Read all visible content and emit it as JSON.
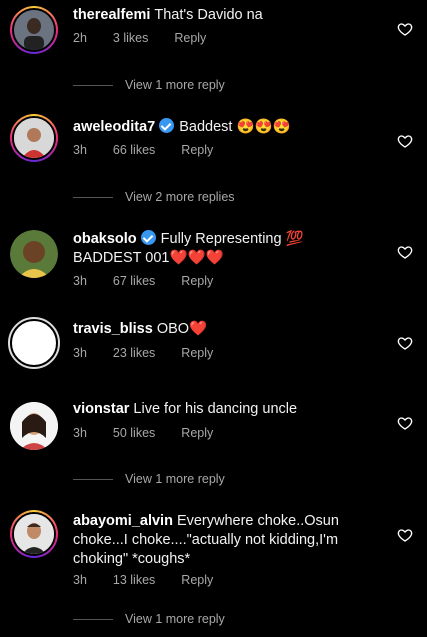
{
  "comments": [
    {
      "username": "therealfemi",
      "text": "That's Davido na",
      "time": "2h",
      "likes": "3 likes",
      "reply": "Reply"
    },
    {
      "username": "aweleodita7",
      "text": "Baddest 😍😍😍",
      "time": "3h",
      "likes": "66 likes",
      "reply": "Reply"
    },
    {
      "username": "obaksolo",
      "text": "Fully Representing 💯 BADDEST 001❤️❤️❤️",
      "time": "3h",
      "likes": "67 likes",
      "reply": "Reply"
    },
    {
      "username": "travis_bliss",
      "text": "OBO❤️",
      "time": "3h",
      "likes": "23 likes",
      "reply": "Reply"
    },
    {
      "username": "vionstar",
      "text": "Live for his dancing uncle",
      "time": "3h",
      "likes": "50 likes",
      "reply": "Reply"
    },
    {
      "username": "abayomi_alvin",
      "text": "Everywhere choke..Osun choke...I choke....\"actually not kidding,I'm choking\" *coughs*",
      "time": "3h",
      "likes": "13 likes",
      "reply": "Reply"
    }
  ],
  "view_more": [
    "View 1 more reply",
    "View 2 more replies",
    "View 1 more reply",
    "View 1 more reply"
  ],
  "icons": {
    "like": "heart-outline-icon",
    "verified": "verified-badge-icon"
  }
}
